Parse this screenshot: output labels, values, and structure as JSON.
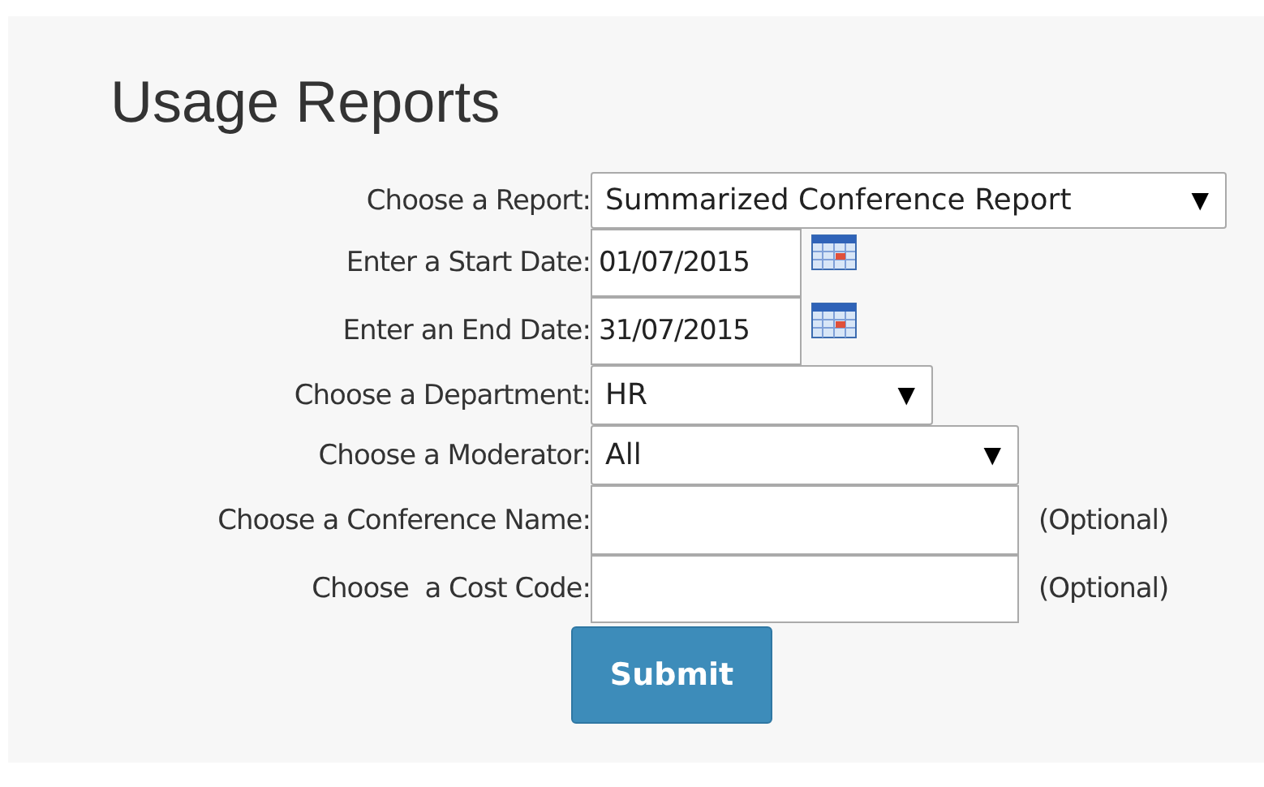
{
  "title": "Usage Reports",
  "fields": [
    {
      "kind": "select",
      "label": "Choose a Report:",
      "value": "Summarized Conference Report",
      "arrow": "▼"
    },
    {
      "kind": "date",
      "label": "Enter a Start Date:",
      "value": "01/07/2015"
    },
    {
      "kind": "date",
      "label": "Enter an End Date:",
      "value": "31/07/2015"
    },
    {
      "kind": "select",
      "label": "Choose a Department:",
      "value": "HR",
      "arrow": "▼"
    },
    {
      "kind": "select",
      "label": "Choose a Moderator:",
      "value": "All",
      "arrow": "▼"
    },
    {
      "kind": "text",
      "label": "Choose a Conference Name:",
      "note": "(Optional)"
    },
    {
      "kind": "text",
      "label": "Choose  a Cost Code:",
      "note": "(Optional)"
    }
  ],
  "submit": "Submit"
}
